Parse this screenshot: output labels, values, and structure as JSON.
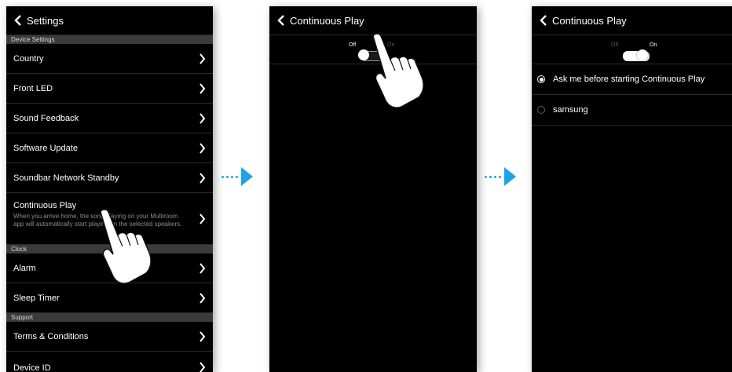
{
  "screen1": {
    "header": {
      "title": "Settings",
      "back_icon": "chevron-left-icon"
    },
    "sections": [
      {
        "title": "Device Settings",
        "items": [
          {
            "label": "Country"
          },
          {
            "label": "Front LED"
          },
          {
            "label": "Sound Feedback"
          },
          {
            "label": "Software Update"
          },
          {
            "label": "Soundbar Network Standby"
          },
          {
            "label": "Continuous Play",
            "description": "When you arrive home, the song playing on your Multiroom app will automatically start playing on the selected speakers."
          }
        ]
      },
      {
        "title": "Clock",
        "items": [
          {
            "label": "Alarm"
          },
          {
            "label": "Sleep Timer"
          }
        ]
      },
      {
        "title": "Support",
        "items": [
          {
            "label": "Terms & Conditions"
          },
          {
            "label": "Device ID"
          }
        ]
      }
    ],
    "row_icon": "chevron-right-icon"
  },
  "screen2": {
    "header": {
      "title": "Continuous Play",
      "back_icon": "chevron-left-icon"
    },
    "toggle": {
      "off_label": "Off",
      "on_label": "On",
      "state": "off"
    }
  },
  "screen3": {
    "header": {
      "title": "Continuous Play",
      "back_icon": "chevron-left-icon"
    },
    "toggle": {
      "off_label": "Off",
      "on_label": "On",
      "state": "on"
    },
    "options": [
      {
        "label": "Ask me before starting Continuous Play",
        "selected": true
      },
      {
        "label": "samsung",
        "selected": false
      }
    ]
  },
  "arrows": {
    "icon": "next-step-arrow-icon",
    "color": "#1ea3e6"
  },
  "colors": {
    "screen_bg": "#000000",
    "section_bg": "#3b3b3b",
    "accent": "#1ea3e6"
  }
}
